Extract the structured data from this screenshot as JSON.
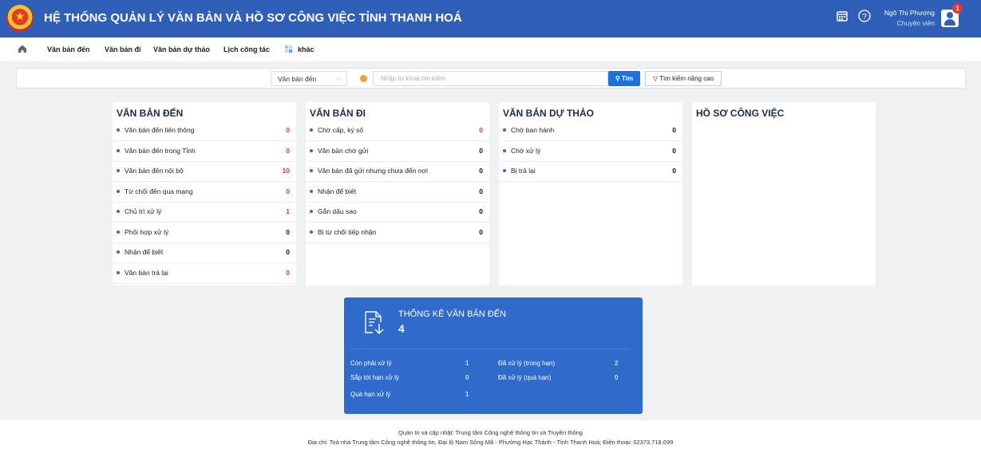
{
  "header": {
    "title": "HỆ THỐNG QUẢN LÝ VĂN BẢN VÀ HỒ SƠ CÔNG VIỆC TỈNH THANH HOÁ",
    "user_name": "Ngô Thị Phương",
    "user_role": "Chuyên viên",
    "notification_count": "1",
    "icons": [
      "emblem-logo",
      "calendar-icon",
      "help-icon",
      "user-avatar-icon"
    ]
  },
  "nav": {
    "items": [
      "Văn bản đến",
      "Văn bản đi",
      "Văn bản dự thảo",
      "Lịch công tác",
      "khác"
    ]
  },
  "search": {
    "selected_type": "Văn bản đến",
    "placeholder": "Nhập từ khoá tìm kiếm",
    "search_label": "Tìm",
    "advanced_label": "Tìm kiếm nâng cao"
  },
  "cards": [
    {
      "title": "VĂN BẢN ĐẾN",
      "rows": [
        {
          "label": "Văn bản đến liên thông",
          "value": "0",
          "highlight": true
        },
        {
          "label": "Văn bản đến trong Tỉnh",
          "value": "0",
          "highlight": true
        },
        {
          "label": "Văn bản đến nội bộ",
          "value": "10",
          "highlight": true
        },
        {
          "label": "Từ chối đến qua mạng",
          "value": "0",
          "highlight": true
        },
        {
          "label": "Chủ trì xử lý",
          "value": "1",
          "highlight": true
        },
        {
          "label": "Phối hợp xử lý",
          "value": "0",
          "highlight": false
        },
        {
          "label": "Nhận để biết",
          "value": "0",
          "highlight": false
        },
        {
          "label": "Văn bản trả lại",
          "value": "0",
          "highlight": true
        }
      ]
    },
    {
      "title": "VĂN BẢN ĐI",
      "rows": [
        {
          "label": "Chờ cấp, ký số",
          "value": "0",
          "highlight": true
        },
        {
          "label": "Văn bản chờ gửi",
          "value": "0",
          "highlight": false
        },
        {
          "label": "Văn bản đã gửi nhưng chưa đến nơi",
          "value": "0",
          "highlight": false
        },
        {
          "label": "Nhận để biết",
          "value": "0",
          "highlight": false
        },
        {
          "label": "Gắn dấu sao",
          "value": "0",
          "highlight": false
        },
        {
          "label": "Bị từ chối tiếp nhận",
          "value": "0",
          "highlight": false
        }
      ]
    },
    {
      "title": "VĂN BẢN DỰ THẢO",
      "rows": [
        {
          "label": "Chờ ban hành",
          "value": "0",
          "highlight": false
        },
        {
          "label": "Chờ xử lý",
          "value": "0",
          "highlight": false
        },
        {
          "label": "Bị trả lại",
          "value": "0",
          "highlight": false
        }
      ]
    },
    {
      "title": "HỒ SƠ CÔNG VIỆC",
      "rows": []
    }
  ],
  "stats": {
    "title": "THỐNG KÊ VĂN BẢN ĐẾN",
    "total": "4",
    "items": [
      {
        "label": "Còn phải xử lý",
        "value": "1"
      },
      {
        "label": "Sắp tới hạn xử lý",
        "value": "0"
      },
      {
        "label": "Quá hạn xử lý",
        "value": "1"
      },
      {
        "label": "Đã xử lý (trong hạn)",
        "value": "2"
      },
      {
        "label": "Đã xử lý (quá hạn)",
        "value": "0"
      }
    ]
  },
  "footer": {
    "line1": "Quản trị và cập nhật: Trung tâm Công nghệ thông tin và Truyền thông",
    "line2": "Địa chỉ: Toà nhà Trung tâm Công nghệ thông tin, Đại lộ Nam Sông Mã - Phường Hạc Thành - Tỉnh Thanh Hoá; Điện thoại: 02373.718.699"
  },
  "colors": {
    "header_bg": "#2f5fb6",
    "primary_button": "#1e73d8",
    "stats_bg": "#2f6bca",
    "alert_value": "#e5362a",
    "list_bullet": "#2f6fd8"
  }
}
